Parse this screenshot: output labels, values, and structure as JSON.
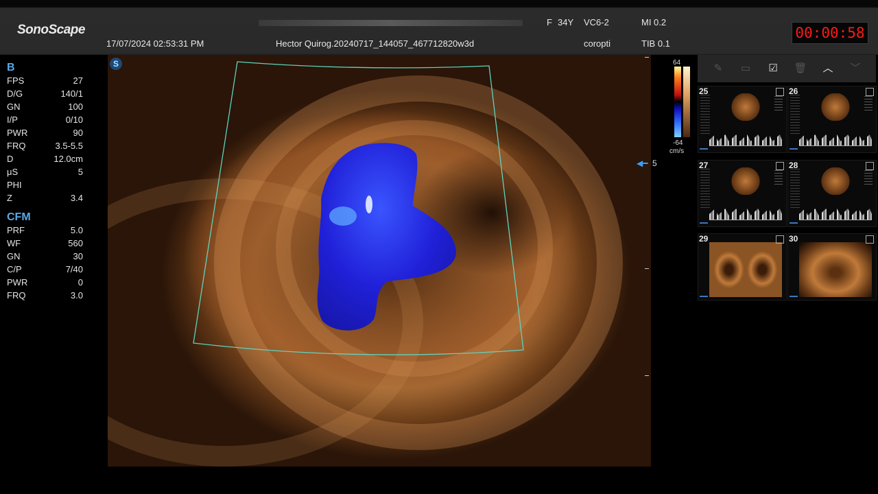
{
  "header": {
    "logo": "SonoScape",
    "datetime": "17/07/2024 02:53:31 PM",
    "patient_id": "Hector Quirog.20240717_144057_467712820w3d",
    "freq_mode": "F",
    "age": "34Y",
    "probe": "VC6-2",
    "preset": "coropti",
    "mi": "MI 0.2",
    "tib": "TIB 0.1",
    "timer": "00:00:58",
    "timer_color": "#ff1a1a"
  },
  "params": {
    "b_title": "B",
    "b_rows": [
      {
        "k": "FPS",
        "v": "27"
      },
      {
        "k": "D/G",
        "v": "140/1"
      },
      {
        "k": "GN",
        "v": "100"
      },
      {
        "k": "I/P",
        "v": "0/10"
      },
      {
        "k": "PWR",
        "v": "90"
      },
      {
        "k": "FRQ",
        "v": "3.5-5.5"
      },
      {
        "k": "D",
        "v": "12.0cm"
      },
      {
        "k": "μS",
        "v": "5"
      },
      {
        "k": "PHI",
        "v": ""
      },
      {
        "k": "Z",
        "v": "3.4"
      }
    ],
    "cfm_title": "CFM",
    "cfm_rows": [
      {
        "k": "PRF",
        "v": "5.0"
      },
      {
        "k": "WF",
        "v": "560"
      },
      {
        "k": "GN",
        "v": "30"
      },
      {
        "k": "C/P",
        "v": "7/40"
      },
      {
        "k": "PWR",
        "v": "0"
      },
      {
        "k": "FRQ",
        "v": "3.0"
      }
    ]
  },
  "image": {
    "badge": "S",
    "depth_marker": "5",
    "accent": "#5aa9e6"
  },
  "colorbar": {
    "top": "64",
    "bottom": "-64",
    "unit": "cm/s"
  },
  "thumbnails": [
    {
      "num": "25",
      "kind": "doppler"
    },
    {
      "num": "26",
      "kind": "doppler"
    },
    {
      "num": "27",
      "kind": "doppler"
    },
    {
      "num": "28",
      "kind": "doppler"
    },
    {
      "num": "29",
      "kind": "dual"
    },
    {
      "num": "30",
      "kind": "full"
    }
  ],
  "toolbar": {
    "icons": [
      "edit-icon",
      "split-icon",
      "check-icon",
      "trash-icon",
      "chevron-up-icon",
      "chevron-down-icon"
    ]
  }
}
